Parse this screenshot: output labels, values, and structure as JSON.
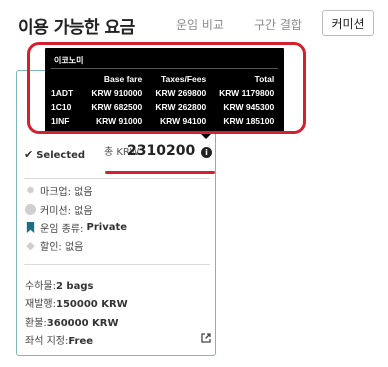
{
  "header": {
    "title": "이용 가능한 요금",
    "tabs": [
      "운임 비교",
      "구간 결합"
    ],
    "commission_button": "커미션"
  },
  "fare_card": {
    "selected_label": "Selected",
    "total_prefix": "총 KRW",
    "total_value": "2310200",
    "features": [
      {
        "icon": "gear-icon",
        "label": "마크업:",
        "value": "없음"
      },
      {
        "icon": "circle-icon",
        "label": "커미션:",
        "value": "없음"
      },
      {
        "icon": "bookmark-icon",
        "label": "운임 종류:",
        "value": "Private"
      },
      {
        "icon": "tag-icon",
        "label": "할인:",
        "value": "없음"
      }
    ],
    "details": [
      {
        "label": "수하물:",
        "value": "2 bags"
      },
      {
        "label": "재발행:",
        "value": "150000 KRW"
      },
      {
        "label": "환불:",
        "value": "360000 KRW"
      },
      {
        "label": "좌석 지정:",
        "value": "Free"
      }
    ]
  },
  "tooltip": {
    "title": "이코노미",
    "columns": [
      "",
      "Base fare",
      "Taxes/Fees",
      "Total"
    ],
    "rows": [
      [
        "1ADT",
        "KRW 910000",
        "KRW 269800",
        "KRW 1179800"
      ],
      [
        "1C10",
        "KRW 682500",
        "KRW 262800",
        "KRW 945300"
      ],
      [
        "1INF",
        "KRW 91000",
        "KRW 94100",
        "KRW 185100"
      ]
    ]
  },
  "colors": {
    "accent_red": "#d32030",
    "card_border": "#7fb7b9",
    "bookmark_teal": "#1b6f80"
  }
}
